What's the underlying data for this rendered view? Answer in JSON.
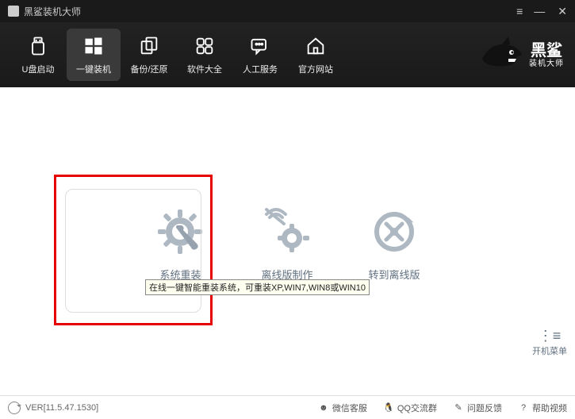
{
  "titlebar": {
    "title": "黑鲨装机大师"
  },
  "toolbar": {
    "items": [
      {
        "label": "U盘启动"
      },
      {
        "label": "一键装机"
      },
      {
        "label": "备份/还原"
      },
      {
        "label": "软件大全"
      },
      {
        "label": "人工服务"
      },
      {
        "label": "官方网站"
      }
    ]
  },
  "logo": {
    "big": "黑鲨",
    "small": "装机大师"
  },
  "main": {
    "options": [
      {
        "label": "系统重装",
        "tooltip": "在线一键智能重装系统，可重装XP,WIN7,WIN8或WIN10"
      },
      {
        "label": "离线版制作"
      },
      {
        "label": "转到离线版"
      }
    ],
    "boot_menu": "开机菜单"
  },
  "statusbar": {
    "version": "VER[11.5.47.1530]",
    "items": [
      {
        "label": "微信客服"
      },
      {
        "label": "QQ交流群"
      },
      {
        "label": "问题反馈"
      },
      {
        "label": "帮助视频"
      }
    ]
  }
}
